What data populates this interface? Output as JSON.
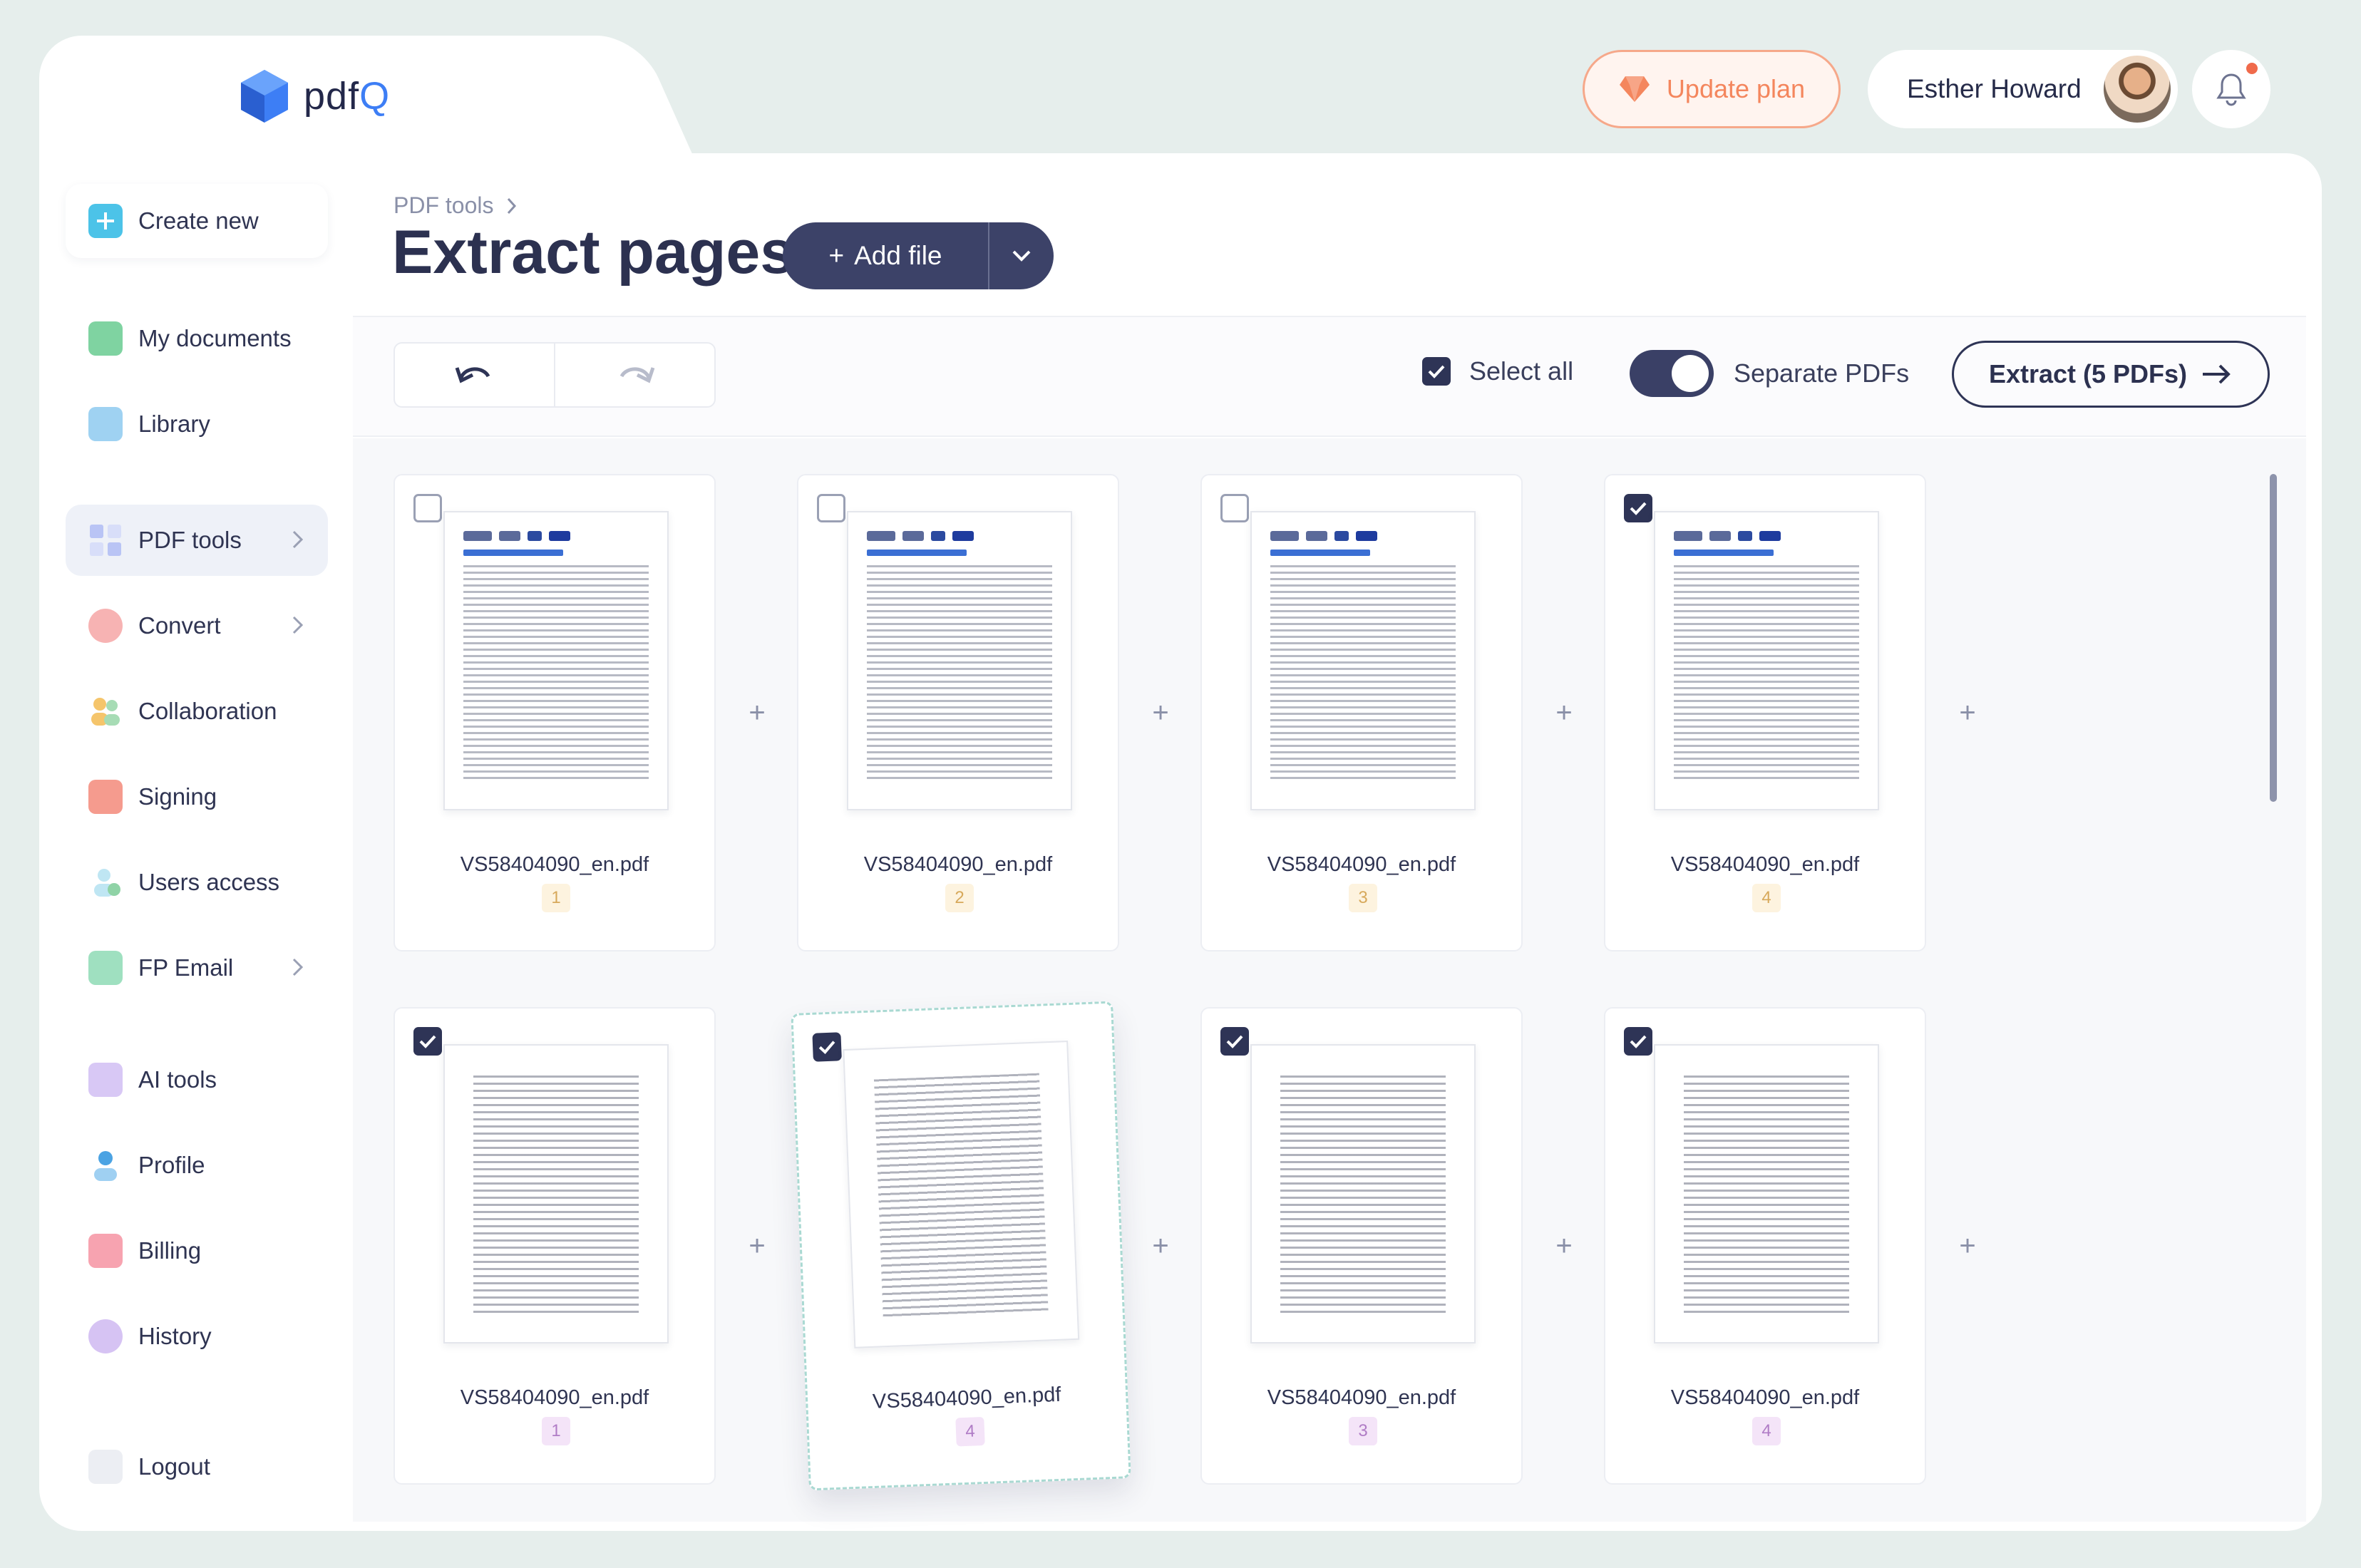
{
  "app": {
    "logo_text_a": "pdf",
    "logo_text_b": "Q"
  },
  "header": {
    "update_plan": "Update plan",
    "user_name": "Esther Howard"
  },
  "sidebar": {
    "items": [
      {
        "label": "Create new",
        "icon": "plus-square-icon"
      },
      {
        "label": "My documents",
        "icon": "folder-icon"
      },
      {
        "label": "Library",
        "icon": "library-icon"
      },
      {
        "label": "PDF tools",
        "icon": "grid-icon"
      },
      {
        "label": "Convert",
        "icon": "convert-icon"
      },
      {
        "label": "Collaboration",
        "icon": "people-icon"
      },
      {
        "label": "Signing",
        "icon": "signature-icon"
      },
      {
        "label": "Users access",
        "icon": "user-check-icon"
      },
      {
        "label": "FP Email",
        "icon": "mail-icon"
      },
      {
        "label": "AI tools",
        "icon": "ai-icon"
      },
      {
        "label": "Profile",
        "icon": "profile-icon"
      },
      {
        "label": "Billing",
        "icon": "card-icon"
      },
      {
        "label": "History",
        "icon": "clock-icon"
      },
      {
        "label": "Logout",
        "icon": "logout-icon"
      }
    ]
  },
  "main": {
    "breadcrumb": "PDF tools",
    "title": "Extract pages",
    "add_file": "Add file"
  },
  "toolbar": {
    "select_all": "Select all",
    "separate_pdfs": "Separate PDFs",
    "extract": "Extract (5 PDFs)"
  },
  "cards": [
    {
      "file": "VS58404090_en.pdf",
      "page": "1",
      "checked": false
    },
    {
      "file": "VS58404090_en.pdf",
      "page": "2",
      "checked": false
    },
    {
      "file": "VS58404090_en.pdf",
      "page": "3",
      "checked": false
    },
    {
      "file": "VS58404090_en.pdf",
      "page": "4",
      "checked": true
    },
    {
      "file": "VS58404090_en.pdf",
      "page": "1",
      "checked": true
    },
    {
      "file": "VS58404090_en.pdf",
      "page": "4",
      "checked": true
    },
    {
      "file": "VS58404090_en.pdf",
      "page": "3",
      "checked": true
    },
    {
      "file": "VS58404090_en.pdf",
      "page": "4",
      "checked": true
    }
  ],
  "colors": {
    "accent": "#3c4268",
    "update": "#f4865d",
    "brand": "#3d7ef5"
  }
}
